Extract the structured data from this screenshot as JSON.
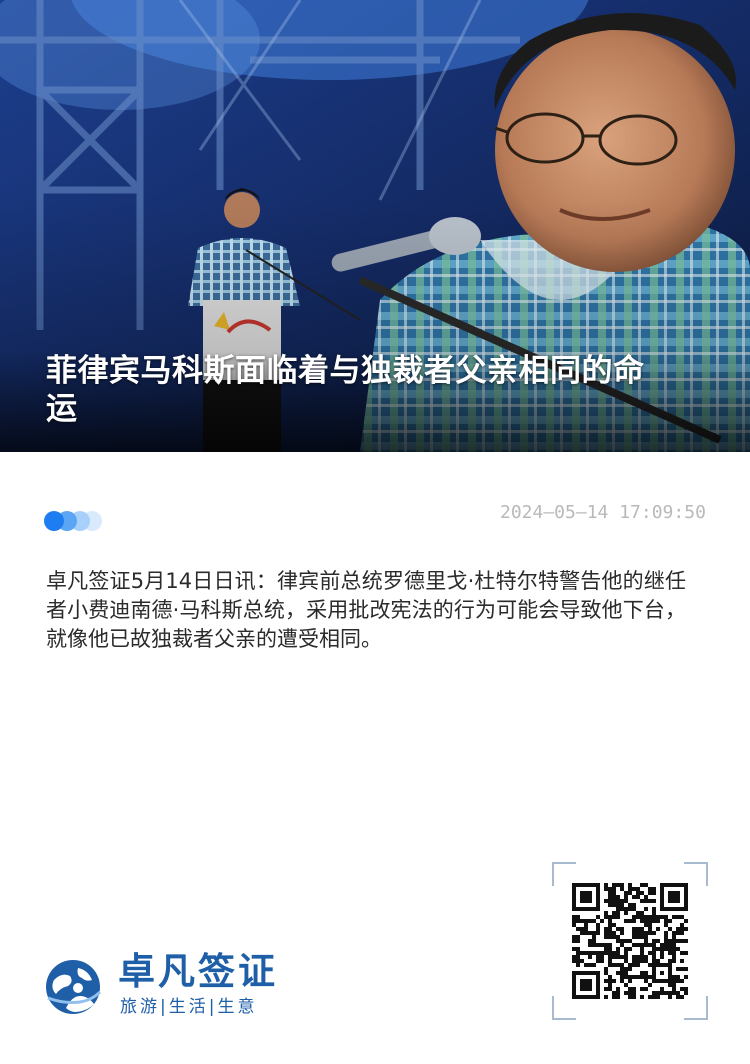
{
  "article": {
    "title": "菲律宾马科斯面临着与独裁者父亲相同的命运",
    "timestamp": "2024—05—14  17:09:50",
    "body": "卓凡签证5月14日日讯：律宾前总统罗德里戈·杜特尔特警告他的继任者小费迪南德·马科斯总统，采用批改宪法的行为可能会导致他下台，就像他已故独裁者父亲的遭受相同。"
  },
  "brand": {
    "name": "卓凡签证",
    "slogan": "旅游|生活|生意",
    "color": "#1f5fa8"
  },
  "icons": {
    "logo": "globe-person-logo",
    "qr": "qr-code",
    "progress": "dots-indicator"
  },
  "colors": {
    "accent": "#1e7df0",
    "timestamp": "#b9b9b9",
    "body_text": "#2b2b2b"
  }
}
